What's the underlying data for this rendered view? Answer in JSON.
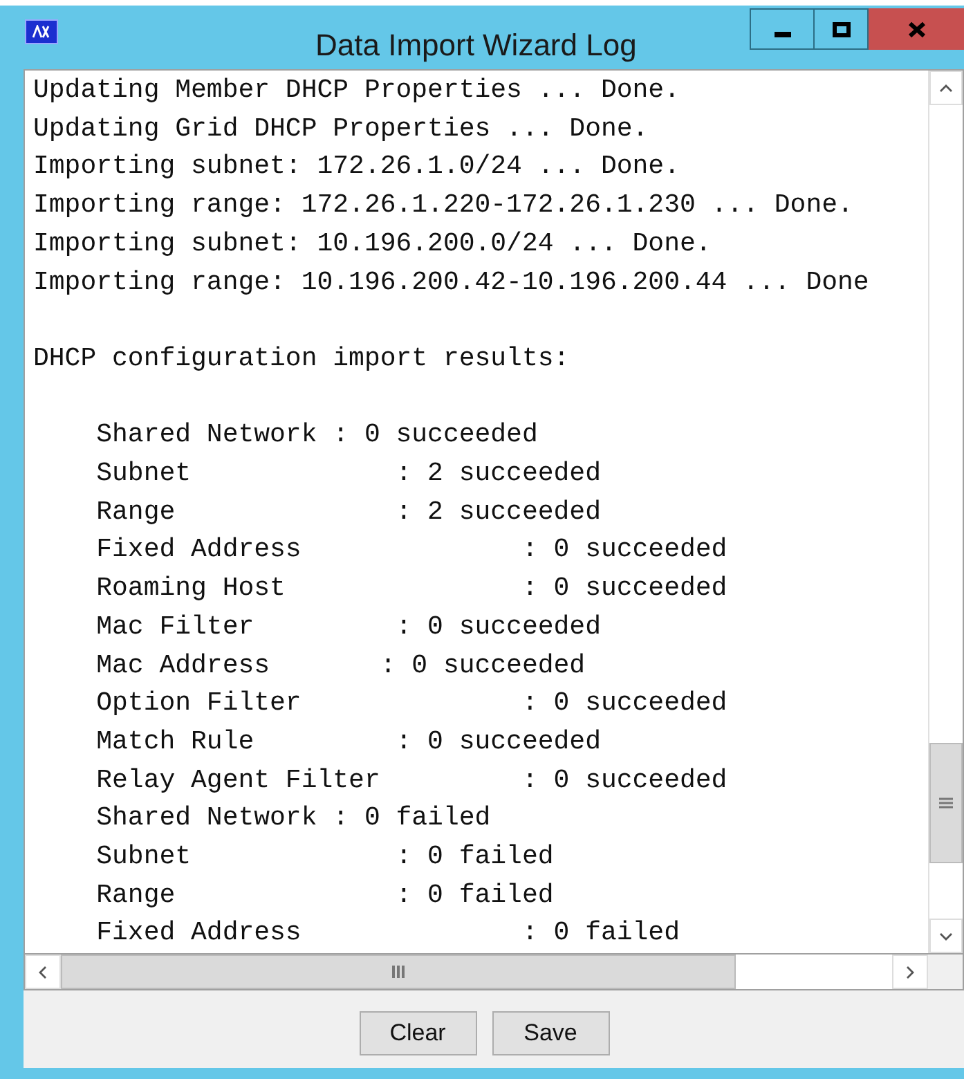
{
  "window": {
    "title": "Data Import Wizard Log"
  },
  "log": {
    "blocks": [
      [
        "Updating Member DHCP Properties ... Done.",
        "Updating Grid DHCP Properties ... Done.",
        "Importing subnet: 172.26.1.0/24 ... Done.",
        "Importing range: 172.26.1.220-172.26.1.230 ... Done.",
        "Importing subnet: 10.196.200.0/24 ... Done.",
        "Importing range: 10.196.200.42-10.196.200.44 ... Done"
      ],
      [
        "DHCP configuration import results:"
      ],
      [
        "    Shared Network : 0 succeeded",
        "    Subnet             : 2 succeeded",
        "    Range              : 2 succeeded",
        "    Fixed Address              : 0 succeeded",
        "    Roaming Host               : 0 succeeded",
        "    Mac Filter         : 0 succeeded",
        "    Mac Address       : 0 succeeded",
        "    Option Filter              : 0 succeeded",
        "    Match Rule         : 0 succeeded",
        "    Relay Agent Filter         : 0 succeeded",
        "    Shared Network : 0 failed",
        "    Subnet             : 0 failed",
        "    Range              : 0 failed",
        "    Fixed Address              : 0 failed"
      ]
    ]
  },
  "buttons": [
    "Clear",
    "Save"
  ]
}
